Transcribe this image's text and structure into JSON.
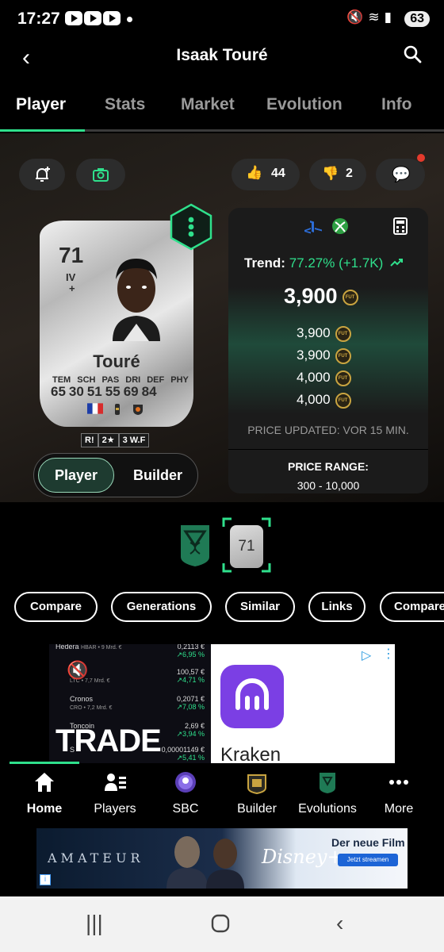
{
  "status_bar": {
    "time": "17:27",
    "battery": "63",
    "icons": [
      "youtube-icon",
      "youtube-icon",
      "youtube-icon",
      "mute-icon",
      "wifi-icon",
      "signal-icon"
    ]
  },
  "header": {
    "title": "Isaak Touré"
  },
  "tabs": [
    {
      "label": "Player",
      "active": true
    },
    {
      "label": "Stats"
    },
    {
      "label": "Market"
    },
    {
      "label": "Evolution"
    },
    {
      "label": "Info"
    }
  ],
  "social": {
    "likes": "44",
    "dislikes": "2"
  },
  "card": {
    "rating": "71",
    "position": "IV",
    "plus": "+",
    "name": "Touré",
    "stat_labels": [
      "TEM",
      "SCH",
      "PAS",
      "DRI",
      "DEF",
      "PHY"
    ],
    "stat_values": [
      "65",
      "30",
      "51",
      "55",
      "69",
      "84"
    ],
    "chips": [
      "R!",
      "2★",
      "3 W.F"
    ]
  },
  "toggle": {
    "player": "Player",
    "builder": "Builder"
  },
  "price": {
    "trend_label": "Trend:",
    "trend_value": "77.27% (+1.7K)",
    "main": "3,900",
    "coin_label": "FUT",
    "rows": [
      "3,900",
      "3,900",
      "4,000",
      "4,000"
    ],
    "updated": "PRICE UPDATED: VOR 15 MIN.",
    "range_title": "PRICE RANGE:",
    "range": "300 - 10,000"
  },
  "evolution": {
    "mini_rating": "71"
  },
  "actions": [
    "Compare",
    "Generations",
    "Similar",
    "Links",
    "Compare"
  ],
  "ad_crypto": {
    "rows": [
      {
        "name": "Hedera",
        "sub": "HBAR • 9 Mrd. €",
        "price": "0,2113 €",
        "change": "↗6,95 %"
      },
      {
        "name": "coin",
        "sub": "LTC • 7,7 Mrd. €",
        "price": "100,57 €",
        "change": "↗4,71 %"
      },
      {
        "name": "Cronos",
        "sub": "CRO • 7,2 Mrd. €",
        "price": "0,2071 €",
        "change": "↗7,08 %"
      },
      {
        "name": "Toncoin",
        "sub": "",
        "price": "2,69 €",
        "change": "↗3,94 %"
      },
      {
        "name": "S",
        "sub": "",
        "price": "0,00001149 €",
        "change": "↗5,41 %"
      }
    ],
    "headline": "TRADE",
    "brand": "Kraken"
  },
  "bottom_nav": [
    {
      "label": "Home",
      "icon": "home-icon",
      "active": true
    },
    {
      "label": "Players",
      "icon": "players-icon"
    },
    {
      "label": "SBC",
      "icon": "sbc-icon"
    },
    {
      "label": "Builder",
      "icon": "builder-icon"
    },
    {
      "label": "Evolutions",
      "icon": "evolutions-icon"
    },
    {
      "label": "More",
      "icon": "more-icon"
    }
  ],
  "ad_disney": {
    "title": "AMATEUR",
    "brand": "Disney+",
    "tagline": "Der neue Film",
    "cta": "Jetzt streamen"
  },
  "colors": {
    "accent": "#2fe08c",
    "background": "#000000",
    "panel": "#1b1b1b",
    "coin": "#c9a440"
  }
}
